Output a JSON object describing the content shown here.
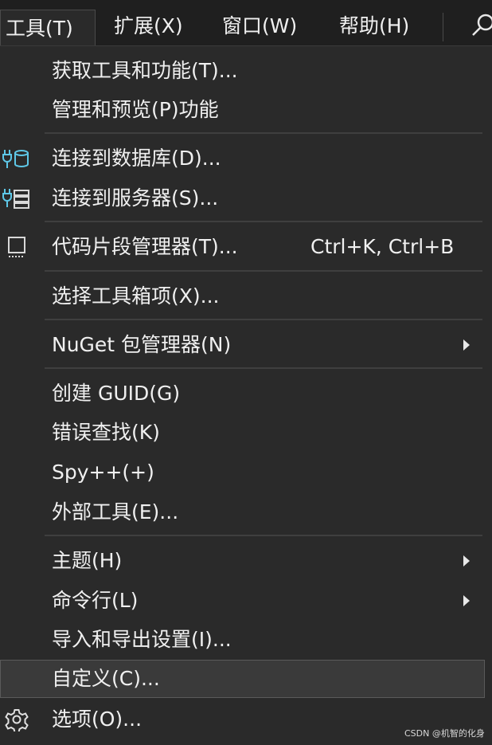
{
  "menubar": {
    "items": [
      {
        "label": "工具(T)"
      },
      {
        "label": "扩展(X)"
      },
      {
        "label": "窗口(W)"
      },
      {
        "label": "帮助(H)"
      }
    ]
  },
  "menu": {
    "items": [
      {
        "label": "获取工具和功能(T)...",
        "shortcut": "",
        "submenu": false,
        "icon": ""
      },
      {
        "label": "管理和预览(P)功能",
        "shortcut": "",
        "submenu": false,
        "icon": ""
      },
      {
        "label": "连接到数据库(D)...",
        "shortcut": "",
        "submenu": false,
        "icon": "database-plug-icon"
      },
      {
        "label": "连接到服务器(S)...",
        "shortcut": "",
        "submenu": false,
        "icon": "server-plug-icon"
      },
      {
        "label": "代码片段管理器(T)...",
        "shortcut": "Ctrl+K, Ctrl+B",
        "submenu": false,
        "icon": "snippet-icon"
      },
      {
        "label": "选择工具箱项(X)...",
        "shortcut": "",
        "submenu": false,
        "icon": ""
      },
      {
        "label": "NuGet 包管理器(N)",
        "shortcut": "",
        "submenu": true,
        "icon": ""
      },
      {
        "label": "创建 GUID(G)",
        "shortcut": "",
        "submenu": false,
        "icon": ""
      },
      {
        "label": "错误查找(K)",
        "shortcut": "",
        "submenu": false,
        "icon": ""
      },
      {
        "label": "Spy++(+)",
        "shortcut": "",
        "submenu": false,
        "icon": ""
      },
      {
        "label": "外部工具(E)...",
        "shortcut": "",
        "submenu": false,
        "icon": ""
      },
      {
        "label": "主题(H)",
        "shortcut": "",
        "submenu": true,
        "icon": ""
      },
      {
        "label": "命令行(L)",
        "shortcut": "",
        "submenu": true,
        "icon": ""
      },
      {
        "label": "导入和导出设置(I)...",
        "shortcut": "",
        "submenu": false,
        "icon": ""
      },
      {
        "label": "自定义(C)...",
        "shortcut": "",
        "submenu": false,
        "icon": "",
        "selected": true
      },
      {
        "label": "选项(O)...",
        "shortcut": "",
        "submenu": false,
        "icon": "gear-icon"
      }
    ]
  },
  "colors": {
    "background": "#2a2a2a",
    "menubar": "#1f1f1f",
    "text": "#f0f0f0",
    "accent_icon": "#5ec8e8",
    "separator": "#3f3f3f",
    "selected": "#3a3a3a"
  },
  "watermark": "CSDN @机智的化身"
}
